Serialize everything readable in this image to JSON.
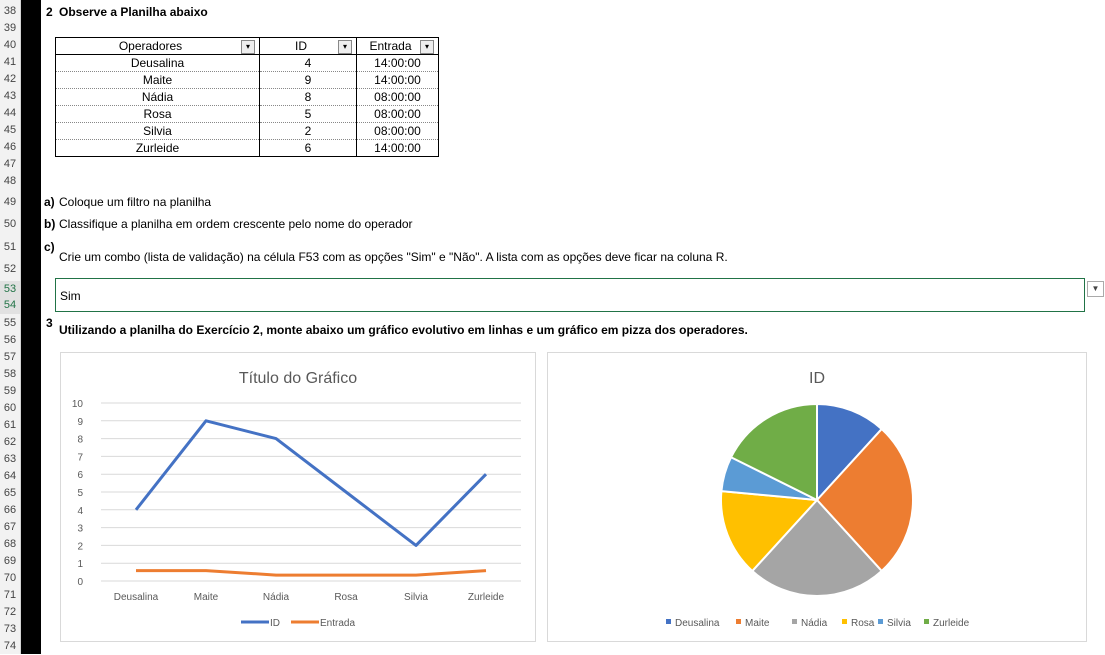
{
  "rows": [
    "38",
    "39",
    "40",
    "41",
    "42",
    "43",
    "44",
    "45",
    "46",
    "47",
    "48",
    "49",
    "50",
    "51",
    "52",
    "53",
    "54",
    "55",
    "56",
    "57",
    "58",
    "59",
    "60",
    "61",
    "62",
    "63",
    "64",
    "65",
    "66",
    "67",
    "68",
    "69",
    "70",
    "71",
    "72",
    "73",
    "74"
  ],
  "exercise2": {
    "number": "2",
    "title": "Observe a Planilha abaixo"
  },
  "table": {
    "headers": [
      "Operadores",
      "ID",
      "Entrada"
    ],
    "rows": [
      [
        "Deusalina",
        "4",
        "14:00:00"
      ],
      [
        "Maite",
        "9",
        "14:00:00"
      ],
      [
        "Nádia",
        "8",
        "08:00:00"
      ],
      [
        "Rosa",
        "5",
        "08:00:00"
      ],
      [
        "Silvia",
        "2",
        "08:00:00"
      ],
      [
        "Zurleide",
        "6",
        "14:00:00"
      ]
    ]
  },
  "tasks": {
    "a_letter": "a)",
    "a_text": "Coloque um filtro na planilha",
    "b_letter": "b)",
    "b_text": "Classifique a planilha em ordem crescente pelo nome do operador",
    "c_letter": "c)",
    "c_text": "Crie um combo (lista de validação) na célula F53 com as opções \"Sim\" e \"Não\". A lista com as opções deve ficar na coluna R."
  },
  "combo": {
    "value": "Sim"
  },
  "exercise3": {
    "number": "3",
    "text": "Utilizando a planilha do Exercício 2, monte abaixo um gráfico evolutivo em linhas e um gráfico em pizza dos operadores."
  },
  "chart_data": [
    {
      "type": "line",
      "title": "Título do Gráfico",
      "categories": [
        "Deusalina",
        "Maite",
        "Nádia",
        "Rosa",
        "Silvia",
        "Zurleide"
      ],
      "series": [
        {
          "name": "ID",
          "values": [
            4,
            9,
            8,
            5,
            2,
            6
          ],
          "color": "#4472c4"
        },
        {
          "name": "Entrada",
          "values": [
            0.583,
            0.583,
            0.333,
            0.333,
            0.333,
            0.583
          ],
          "color": "#ed7d31"
        }
      ],
      "ylim": [
        0,
        10
      ],
      "yticks": [
        "0",
        "1",
        "2",
        "3",
        "4",
        "5",
        "6",
        "7",
        "8",
        "9",
        "10"
      ],
      "grid": true,
      "legend": "bottom"
    },
    {
      "type": "pie",
      "title": "ID",
      "categories": [
        "Deusalina",
        "Maite",
        "Nádia",
        "Rosa",
        "Silvia",
        "Zurleide"
      ],
      "values": [
        4,
        9,
        8,
        5,
        2,
        6
      ],
      "colors": [
        "#4472c4",
        "#ed7d31",
        "#a5a5a5",
        "#ffc000",
        "#5b9bd5",
        "#70ad47"
      ],
      "legend": "bottom"
    }
  ]
}
